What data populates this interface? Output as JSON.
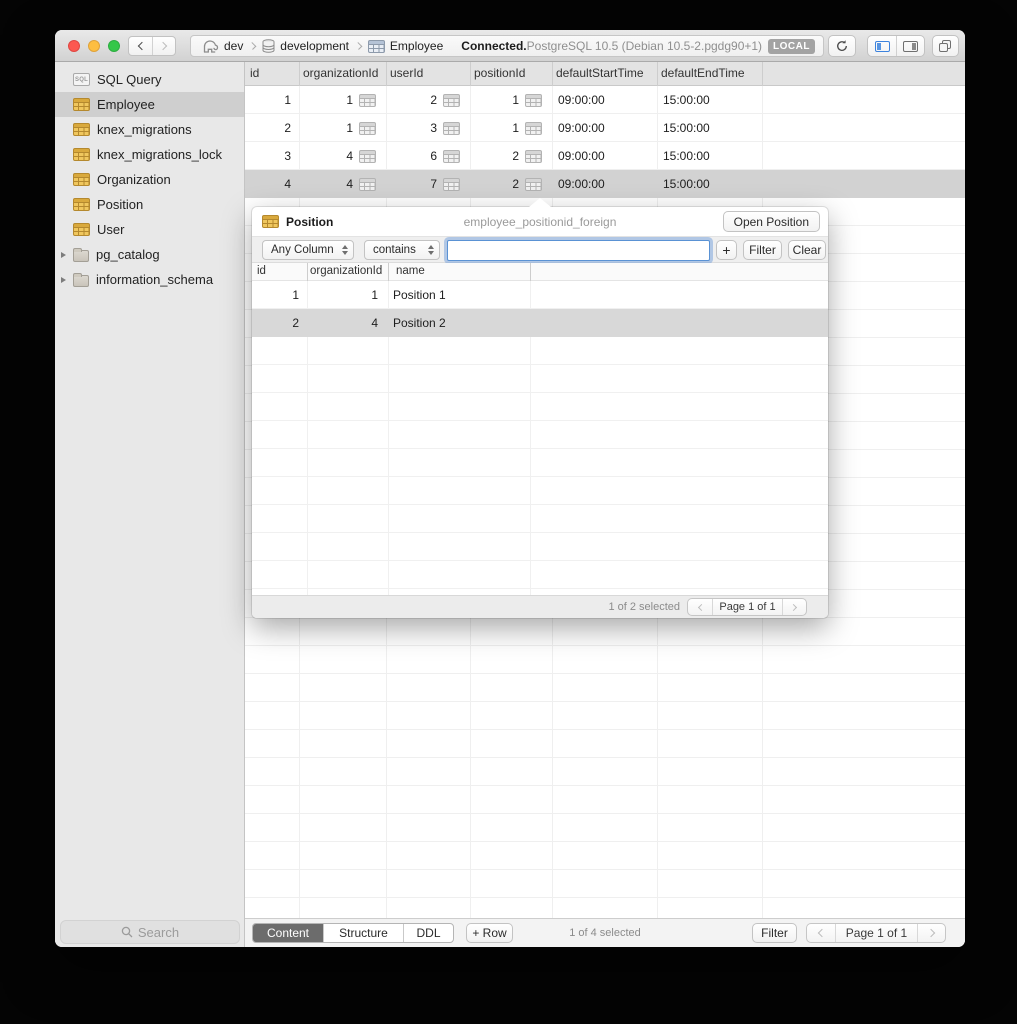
{
  "window": {
    "titlebar": {
      "breadcrumb": [
        {
          "label": "dev",
          "icon": "postgres-elephant"
        },
        {
          "label": "development",
          "icon": "database"
        },
        {
          "label": "Employee",
          "icon": "table"
        }
      ],
      "status": "Connected.",
      "server_version": "PostgreSQL 10.5 (Debian 10.5-2.pgdg90+1)",
      "location_badge": "LOCAL"
    },
    "sidebar": {
      "sql_badge": "SQL",
      "items": [
        {
          "label": "SQL Query",
          "icon": "sql"
        },
        {
          "label": "Employee",
          "icon": "table",
          "selected": true
        },
        {
          "label": "knex_migrations",
          "icon": "table"
        },
        {
          "label": "knex_migrations_lock",
          "icon": "table"
        },
        {
          "label": "Organization",
          "icon": "table"
        },
        {
          "label": "Position",
          "icon": "table"
        },
        {
          "label": "User",
          "icon": "table"
        },
        {
          "label": "pg_catalog",
          "icon": "folder",
          "expandable": true
        },
        {
          "label": "information_schema",
          "icon": "folder",
          "expandable": true
        }
      ],
      "search_placeholder": "Search"
    },
    "table": {
      "columns": [
        "id",
        "organizationId",
        "userId",
        "positionId",
        "defaultStartTime",
        "defaultEndTime"
      ],
      "rows": [
        {
          "id": "1",
          "organizationId": "1",
          "userId": "2",
          "positionId": "1",
          "defaultStartTime": "09:00:00",
          "defaultEndTime": "15:00:00"
        },
        {
          "id": "2",
          "organizationId": "1",
          "userId": "3",
          "positionId": "1",
          "defaultStartTime": "09:00:00",
          "defaultEndTime": "15:00:00"
        },
        {
          "id": "3",
          "organizationId": "4",
          "userId": "6",
          "positionId": "2",
          "defaultStartTime": "09:00:00",
          "defaultEndTime": "15:00:00"
        },
        {
          "id": "4",
          "organizationId": "4",
          "userId": "7",
          "positionId": "2",
          "defaultStartTime": "09:00:00",
          "defaultEndTime": "15:00:00",
          "selected": true
        }
      ]
    },
    "popover": {
      "title": "Position",
      "reference": "employee_positionid_foreign",
      "open_button": "Open Position",
      "filter_bar": {
        "column_select": "Any Column",
        "operator_select": "contains",
        "search_value": "",
        "add_button": "+",
        "filter_button": "Filter",
        "clear_button": "Clear"
      },
      "table": {
        "columns": [
          "id",
          "organizationId",
          "name"
        ],
        "rows": [
          {
            "id": "1",
            "organizationId": "1",
            "name": "Position 1"
          },
          {
            "id": "2",
            "organizationId": "4",
            "name": "Position 2",
            "selected": true
          }
        ]
      },
      "footer": {
        "selection_status": "1 of 2 selected",
        "page_status": "Page 1 of 1"
      }
    },
    "toolbar": {
      "view_tabs": [
        {
          "label": "Content",
          "active": true
        },
        {
          "label": "Structure"
        },
        {
          "label": "DDL"
        }
      ],
      "add_row_button": "+ Row",
      "selection_status": "1 of 4 selected",
      "filter_button": "Filter",
      "page_status": "Page 1 of 1"
    }
  }
}
